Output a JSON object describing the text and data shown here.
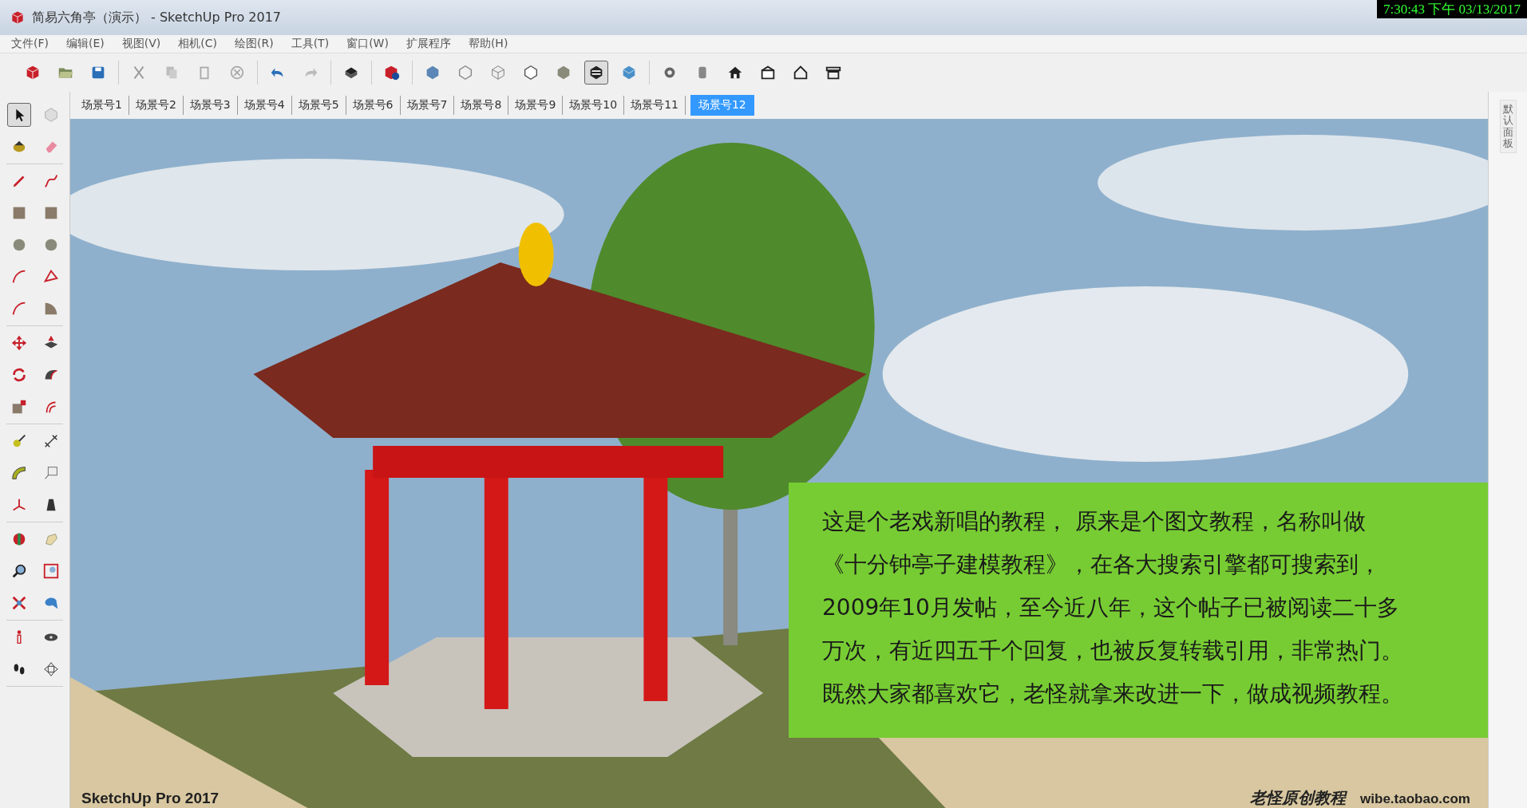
{
  "window": {
    "title": "简易六角亭（演示） - SketchUp Pro 2017",
    "clock": "7:30:43 下午 03/13/2017"
  },
  "menu": [
    "文件(F)",
    "编辑(E)",
    "视图(V)",
    "相机(C)",
    "绘图(R)",
    "工具(T)",
    "窗口(W)",
    "扩展程序",
    "帮助(H)"
  ],
  "scene_tabs": [
    {
      "label": "场景号1",
      "selected": false
    },
    {
      "label": "场景号2",
      "selected": false
    },
    {
      "label": "场景号3",
      "selected": false
    },
    {
      "label": "场景号4",
      "selected": false
    },
    {
      "label": "场景号5",
      "selected": false
    },
    {
      "label": "场景号6",
      "selected": false
    },
    {
      "label": "场景号7",
      "selected": false
    },
    {
      "label": "场景号8",
      "selected": false
    },
    {
      "label": "场景号9",
      "selected": false
    },
    {
      "label": "场景号10",
      "selected": false
    },
    {
      "label": "场景号11",
      "selected": false
    },
    {
      "label": "场景号12",
      "selected": true
    }
  ],
  "viewport": {
    "kind": "picture",
    "note_lines": [
      "这是个老戏新唱的教程， 原来是个图文教程，名称叫做",
      "《十分钟亭子建模教程》，在各大搜索引擎都可搜索到，",
      "2009年10月发帖，至今近八年，这个帖子已被阅读二十多",
      "万次，有近四五千个回复，也被反复转载引用，非常热门。",
      "既然大家都喜欢它，老怪就拿来改进一下，做成视频教程。"
    ],
    "watermark": "SketchUp Pro 2017",
    "author": "老怪原创教程",
    "site": "wibe.taobao.com"
  },
  "side_panel": {
    "tab": "默认面板"
  }
}
